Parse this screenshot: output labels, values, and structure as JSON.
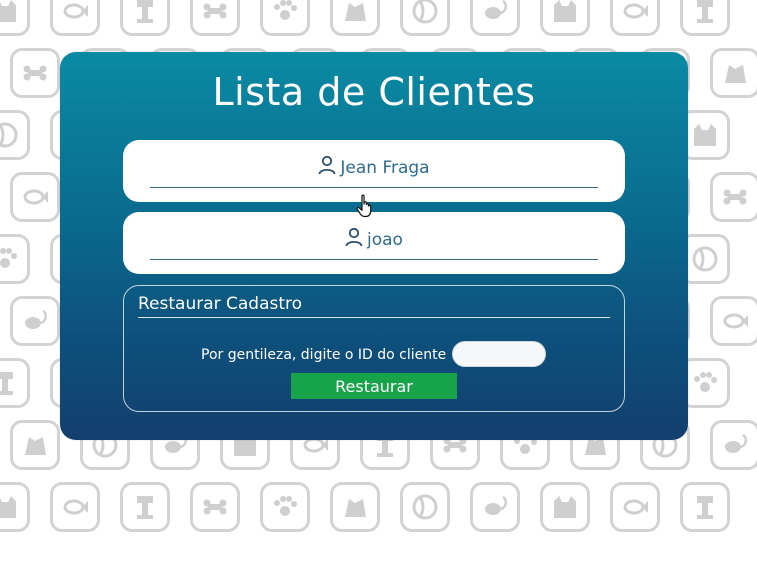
{
  "page": {
    "title": "Lista de Clientes"
  },
  "clients": [
    {
      "name": "Jean Fraga",
      "icon": "user-icon"
    },
    {
      "name": "joao",
      "icon": "user-icon"
    }
  ],
  "restore": {
    "heading": "Restaurar Cadastro",
    "prompt": "Por gentileza, digite o ID do cliente",
    "input_value": "",
    "button_label": "Restaurar"
  },
  "colors": {
    "panel_top": "#0b8aa4",
    "panel_bottom": "#133f6e",
    "accent_text": "#2d6d8f",
    "button": "#16a34a",
    "background_tile": "#d3d3d3"
  },
  "background": {
    "pattern_icons": [
      "cat-icon",
      "fish-icon",
      "scratch-post-icon",
      "bone-icon",
      "paw-icon",
      "dog-icon",
      "ball-icon",
      "mouse-icon"
    ]
  }
}
